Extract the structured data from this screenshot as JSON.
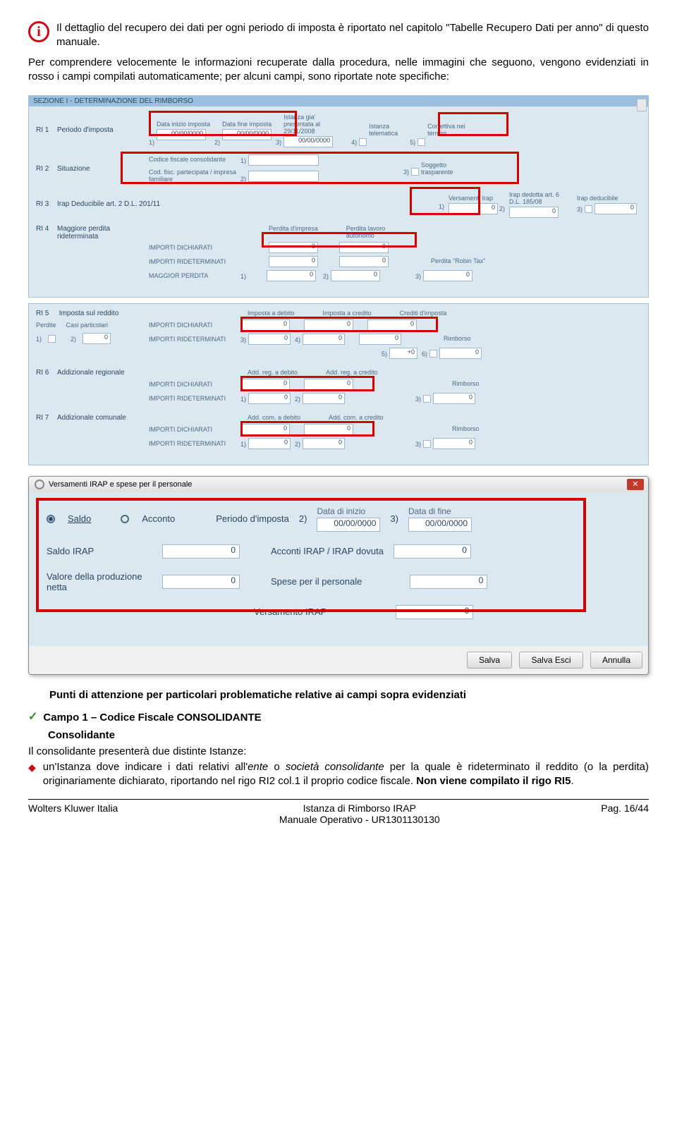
{
  "info_text": "Il dettaglio del recupero dei dati per ogni periodo di imposta è riportato nel capitolo \"Tabelle Recupero Dati per anno\" di questo manuale.",
  "body_text": "Per comprendere velocemente le informazioni recuperate dalla procedura, nelle immagini che seguono, vengono evidenziati in rosso i campi compilati automaticamente; per alcuni campi, sono riportate note specifiche:",
  "section_title": "SEZIONE I - DETERMINAZIONE DEL RIMBORSO",
  "ri1": {
    "code": "RI 1",
    "desc": "Periodo d'imposta",
    "l1": "Data inizio imposta",
    "v1": "00/00/0000",
    "l2": "Data fine imposta",
    "v2": "00/00/0000",
    "l3": "Istanza gia' presentata al 29/11/2008",
    "v3": "00/00/0000",
    "l4": "Istanza telematica",
    "l5": "Correttiva nei termini"
  },
  "ri2": {
    "code": "RI 2",
    "desc": "Situazione",
    "l1": "Codice fiscale consolidante",
    "l2": "Cod. fisc. partecipata / impresa familiare",
    "l3": "Soggetto trasparente"
  },
  "ri3": {
    "code": "RI 3",
    "desc": "Irap Deducibile art. 2 D.L. 201/11",
    "l1": "Versamenti Irap",
    "l2": "Irap dedotta art. 6 D.L. 185/08",
    "l3": "Irap deducibile",
    "zero": "0"
  },
  "ri4": {
    "code": "RI 4",
    "desc": "Maggiore perdita rideterminata",
    "r1": "IMPORTI DICHIARATI",
    "r2": "IMPORTI RIDETERMINATI",
    "r3": "MAGGIOR PERDITA",
    "c1": "Perdita d'impresa",
    "c2": "Perdita lavoro autonomo",
    "c3": "Perdita \"Robin Tax\"",
    "zero": "0"
  },
  "ri5": {
    "code": "RI 5",
    "desc": "Imposta sul reddito",
    "sub1": "Perdite",
    "sub2": "Casi particolari",
    "r1": "IMPORTI DICHIARATI",
    "r2": "IMPORTI RIDETERMINATI",
    "c1": "Imposta a debito",
    "c2": "Imposta a credito",
    "c3": "Crediti d'imposta",
    "c4": "Rimborso",
    "zero": "0",
    "plus0": "+0"
  },
  "ri6": {
    "code": "RI 6",
    "desc": "Addizionale regionale",
    "r1": "IMPORTI DICHIARATI",
    "r2": "IMPORTI RIDETERMINATI",
    "c1": "Add. reg. a debito",
    "c2": "Add. reg. a credito",
    "c4": "Rimborso",
    "zero": "0"
  },
  "ri7": {
    "code": "RI 7",
    "desc": "Addizionale comunale",
    "r1": "IMPORTI DICHIARATI",
    "r2": "IMPORTI RIDETERMINATI",
    "c1": "Add. com. a debito",
    "c2": "Add. com. a credito",
    "c4": "Rimborso",
    "zero": "0"
  },
  "dialog": {
    "title": "Versamenti IRAP e spese per il personale",
    "saldo": "Saldo",
    "acconto": "Acconto",
    "periodo": "Periodo d'imposta",
    "di_inizio": "Data di inizio",
    "di_fine": "Data di fine",
    "date": "00/00/0000",
    "saldo_irap": "Saldo IRAP",
    "acconti": "Acconti IRAP / IRAP dovuta",
    "valore": "Valore della produzione netta",
    "spese": "Spese per il personale",
    "vers": "Versamento IRAP",
    "zero": "0",
    "b1": "Salva",
    "b2": "Salva Esci",
    "b3": "Annulla"
  },
  "attn_title": "Punti di attenzione per particolari problematiche relative ai campi sopra evidenziati",
  "campo1": "Campo 1 – Codice Fiscale CONSOLIDANTE",
  "consolidante": "Consolidante",
  "list_intro": "Il consolidante presenterà due distinte Istanze:",
  "bullet_text_part1": "un'Istanza dove indicare i dati relativi all'",
  "bullet_em1": "ente",
  "bullet_mid": " o ",
  "bullet_em2": "società consolidante",
  "bullet_text_part2": " per la quale è rideterminato il reddito (o la perdita) originariamente dichiarato, riportando nel rigo RI2 col.1 il proprio codice fiscale. ",
  "bullet_bold": "Non viene compilato il rigo RI5",
  "bullet_end": ".",
  "footer": {
    "left": "Wolters Kluwer Italia",
    "center1": "Istanza di Rimborso IRAP",
    "center2": "Manuale Operativo - UR1301130130",
    "right": "Pag. 16/44"
  }
}
